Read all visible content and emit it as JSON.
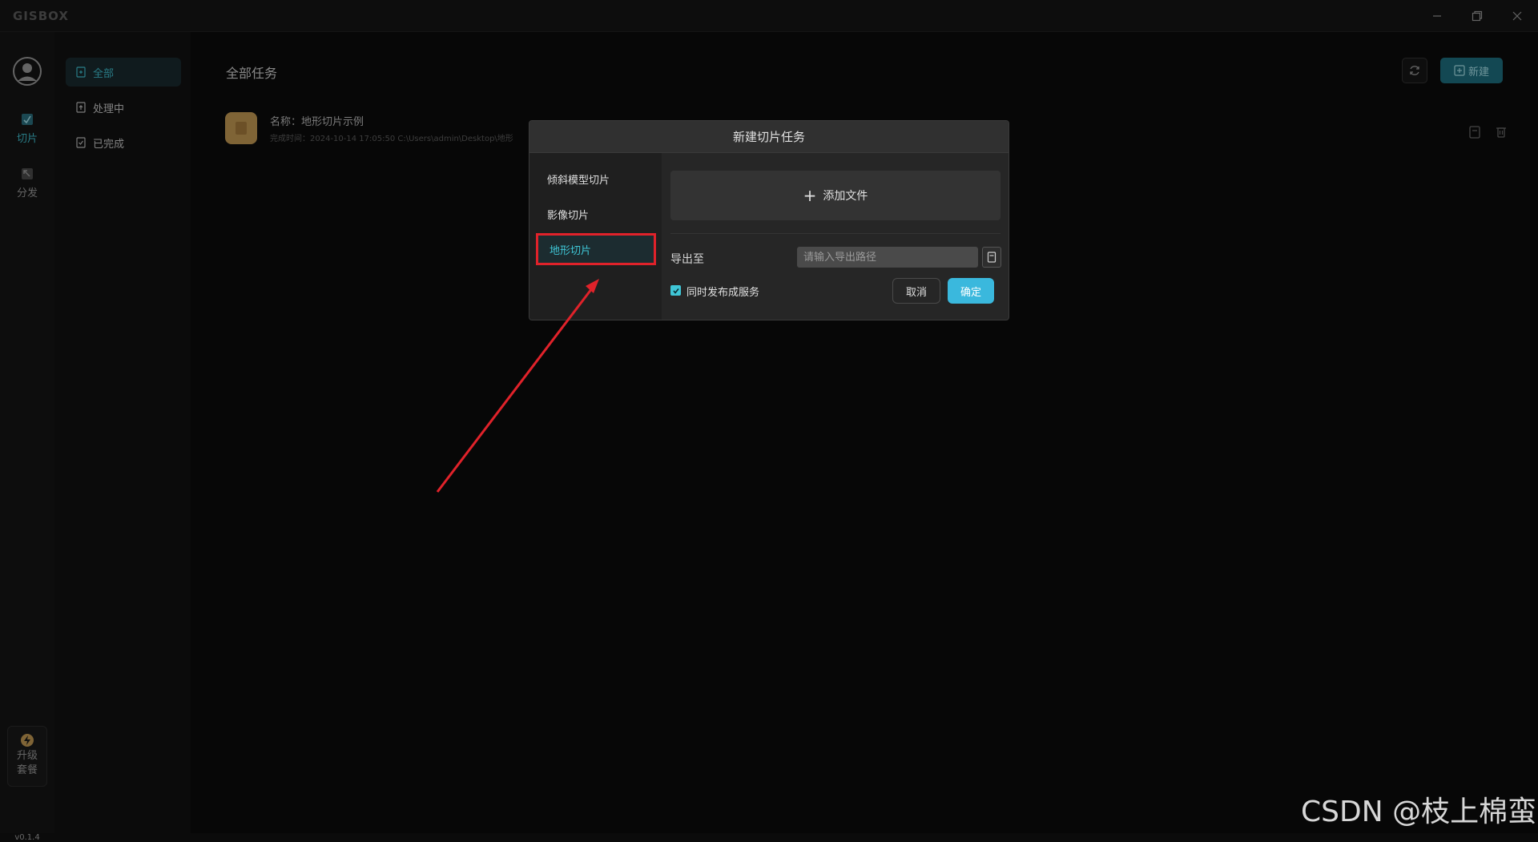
{
  "app": {
    "logo_text": "GISBOX",
    "version": "v0.1.4"
  },
  "rail": {
    "items": [
      {
        "label": "切片",
        "icon": "slice-icon",
        "active": true
      },
      {
        "label": "分发",
        "icon": "distribute-icon",
        "active": false
      }
    ],
    "upgrade": {
      "line1": "升级",
      "line2": "套餐",
      "icon": "lightning-icon"
    }
  },
  "subnav": {
    "items": [
      {
        "label": "全部",
        "active": true
      },
      {
        "label": "处理中",
        "active": false
      },
      {
        "label": "已完成",
        "active": false
      }
    ]
  },
  "main": {
    "title": "全部任务",
    "new_button": "新建",
    "task": {
      "name": "名称：地形切片示例",
      "meta": "完成时间：2024-10-14 17:05:50   C:\\Users\\admin\\Desktop\\地形"
    }
  },
  "dialog": {
    "title": "新建切片任务",
    "side_items": [
      {
        "label": "倾斜模型切片",
        "active": false
      },
      {
        "label": "影像切片",
        "active": false
      },
      {
        "label": "地形切片",
        "active": true
      }
    ],
    "add_file": "添加文件",
    "export_label": "导出至",
    "export_placeholder": "请输入导出路径",
    "publish_label": "同时发布成服务",
    "publish_checked": true,
    "cancel": "取消",
    "ok": "确定"
  },
  "annotation": {
    "highlight_color": "#e0222a"
  },
  "watermark": "CSDN @枝上棉蛮",
  "colors": {
    "accent": "#3fc6d6",
    "primary_button": "#3ab8dd",
    "new_button": "#1e6f80"
  }
}
